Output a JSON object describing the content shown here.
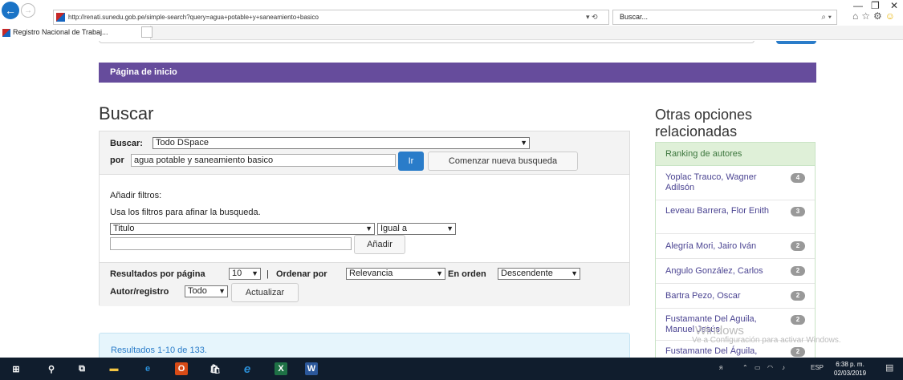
{
  "browser": {
    "url": "http://renati.sunedu.gob.pe/simple-search?query=agua+potable+y+saneamiento+basico",
    "url_controls": "▾ ⟲",
    "search_placeholder": "Buscar...",
    "tab_title": "Registro Nacional de Trabaj...",
    "tab_close": "×",
    "win_min": "—",
    "win_restore": "❐",
    "win_close": "✕"
  },
  "page": {
    "breadcrumb": "Página de inicio",
    "heading": "Buscar",
    "form": {
      "buscar_label": "Buscar:",
      "scope_value": "Todo DSpace",
      "por_label": "por",
      "query_value": "agua potable y saneamiento basico",
      "go_button": "Ir",
      "new_search_button": "Comenzar nueva busqueda",
      "filters_title": "Añadir filtros:",
      "filters_hint": "Usa los filtros para afinar la busqueda.",
      "filter_field": "Titulo",
      "filter_operator": "Igual a",
      "filter_value": "",
      "add_button": "Añadir",
      "rpp_label": "Resultados por página",
      "rpp_value": "10",
      "separator": "|",
      "sort_label": "Ordenar por",
      "sort_value": "Relevancia",
      "order_label": "En orden",
      "order_value": "Descendente",
      "author_label": "Autor/registro",
      "author_value": "Todo",
      "update_button": "Actualizar"
    },
    "results_text": "Resultados 1-10 de 133."
  },
  "sidebar": {
    "heading": "Otras opciones relacionadas",
    "ranking_title": "Ranking de autores",
    "authors": [
      {
        "name": "Yoplac Trauco, Wagner Adilsón",
        "count": "4"
      },
      {
        "name": "Leveau Barrera, Flor Enith",
        "count": "3"
      },
      {
        "name": "Alegría Mori, Jairo Iván",
        "count": "2"
      },
      {
        "name": "Angulo González, Carlos",
        "count": "2"
      },
      {
        "name": "Bartra Pezo, Oscar",
        "count": "2"
      },
      {
        "name": "Fustamante Del Aguila, Manuel Jesús",
        "count": "2"
      },
      {
        "name": "Fustamante Del Águila,",
        "count": "2"
      }
    ]
  },
  "watermark": {
    "line1": "Windows",
    "line2": "Ve a Configuración para activar Windows."
  },
  "taskbar": {
    "lang": "ESP",
    "time": "6:38 p. m.",
    "date": "02/03/2019"
  }
}
